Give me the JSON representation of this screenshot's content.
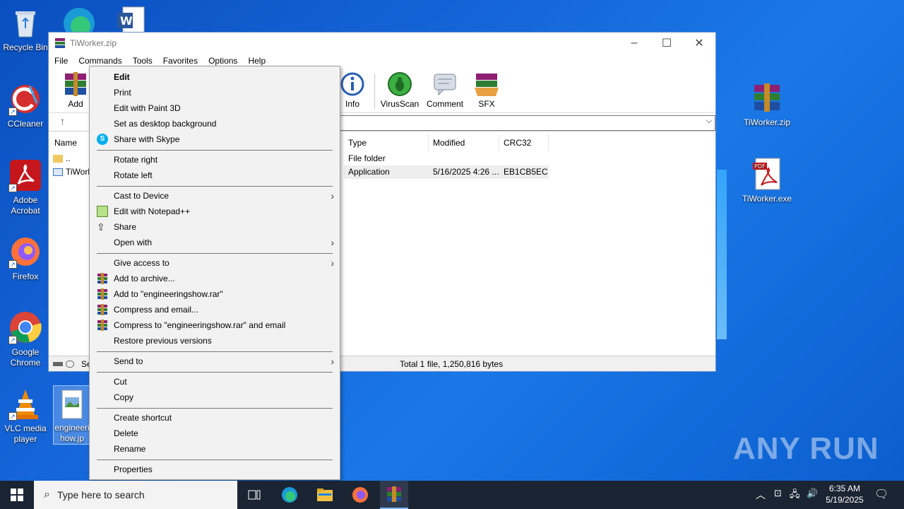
{
  "desktop": {
    "icons": [
      {
        "label": "Recycle Bin"
      },
      {
        "label": "CCleaner"
      },
      {
        "label": "Adobe Acrobat"
      },
      {
        "label": "Firefox"
      },
      {
        "label": "Google Chrome"
      },
      {
        "label": "VLC media player"
      },
      {
        "label": "engineeringshow.jpg",
        "label_visible": "engineeri how.jp"
      },
      {
        "label": "TiWorker.zip"
      },
      {
        "label": "TiWorker.exe"
      }
    ]
  },
  "window": {
    "title": "TiWorker.zip",
    "menu": [
      "File",
      "Commands",
      "Tools",
      "Favorites",
      "Options",
      "Help"
    ],
    "toolbar": {
      "add": "Add",
      "info": "Info",
      "virusscan": "VirusScan",
      "comment": "Comment",
      "sfx": "SFX"
    },
    "columns": {
      "name": "Name",
      "type": "Type",
      "modified": "Modified",
      "crc": "CRC32"
    },
    "rows": [
      {
        "name": "..",
        "type": "File folder",
        "modified": "",
        "crc": ""
      },
      {
        "name": "TiWork",
        "type": "Application",
        "modified": "5/16/2025 4:26 ...",
        "crc": "EB1CB5EC"
      }
    ],
    "status_left": "Se",
    "status": "Total 1 file, 1,250,816 bytes"
  },
  "context_menu": {
    "items": [
      {
        "label": "Edit",
        "bold": true
      },
      {
        "label": "Print"
      },
      {
        "label": "Edit with Paint 3D"
      },
      {
        "label": "Set as desktop background"
      },
      {
        "label": "Share with Skype",
        "icon": "skype-icon"
      },
      {
        "label": "Rotate right"
      },
      {
        "label": "Rotate left"
      },
      {
        "label": "Cast to Device",
        "submenu": true
      },
      {
        "label": "Edit with Notepad++",
        "icon": "notepadpp-icon"
      },
      {
        "label": "Share",
        "icon": "share-icon"
      },
      {
        "label": "Open with",
        "submenu": true
      },
      {
        "label": "Give access to",
        "submenu": true
      },
      {
        "label": "Add to archive...",
        "icon": "winrar-icon"
      },
      {
        "label": "Add to \"engineeringshow.rar\"",
        "icon": "winrar-icon"
      },
      {
        "label": "Compress and email...",
        "icon": "winrar-icon"
      },
      {
        "label": "Compress to \"engineeringshow.rar\" and email",
        "icon": "winrar-icon"
      },
      {
        "label": "Restore previous versions"
      },
      {
        "label": "Send to",
        "submenu": true
      },
      {
        "label": "Cut"
      },
      {
        "label": "Copy"
      },
      {
        "label": "Create shortcut"
      },
      {
        "label": "Delete"
      },
      {
        "label": "Rename"
      },
      {
        "label": "Properties"
      }
    ]
  },
  "taskbar": {
    "search_placeholder": "Type here to search",
    "time": "6:35 AM",
    "date": "5/19/2025"
  },
  "watermark": "ANY RUN"
}
